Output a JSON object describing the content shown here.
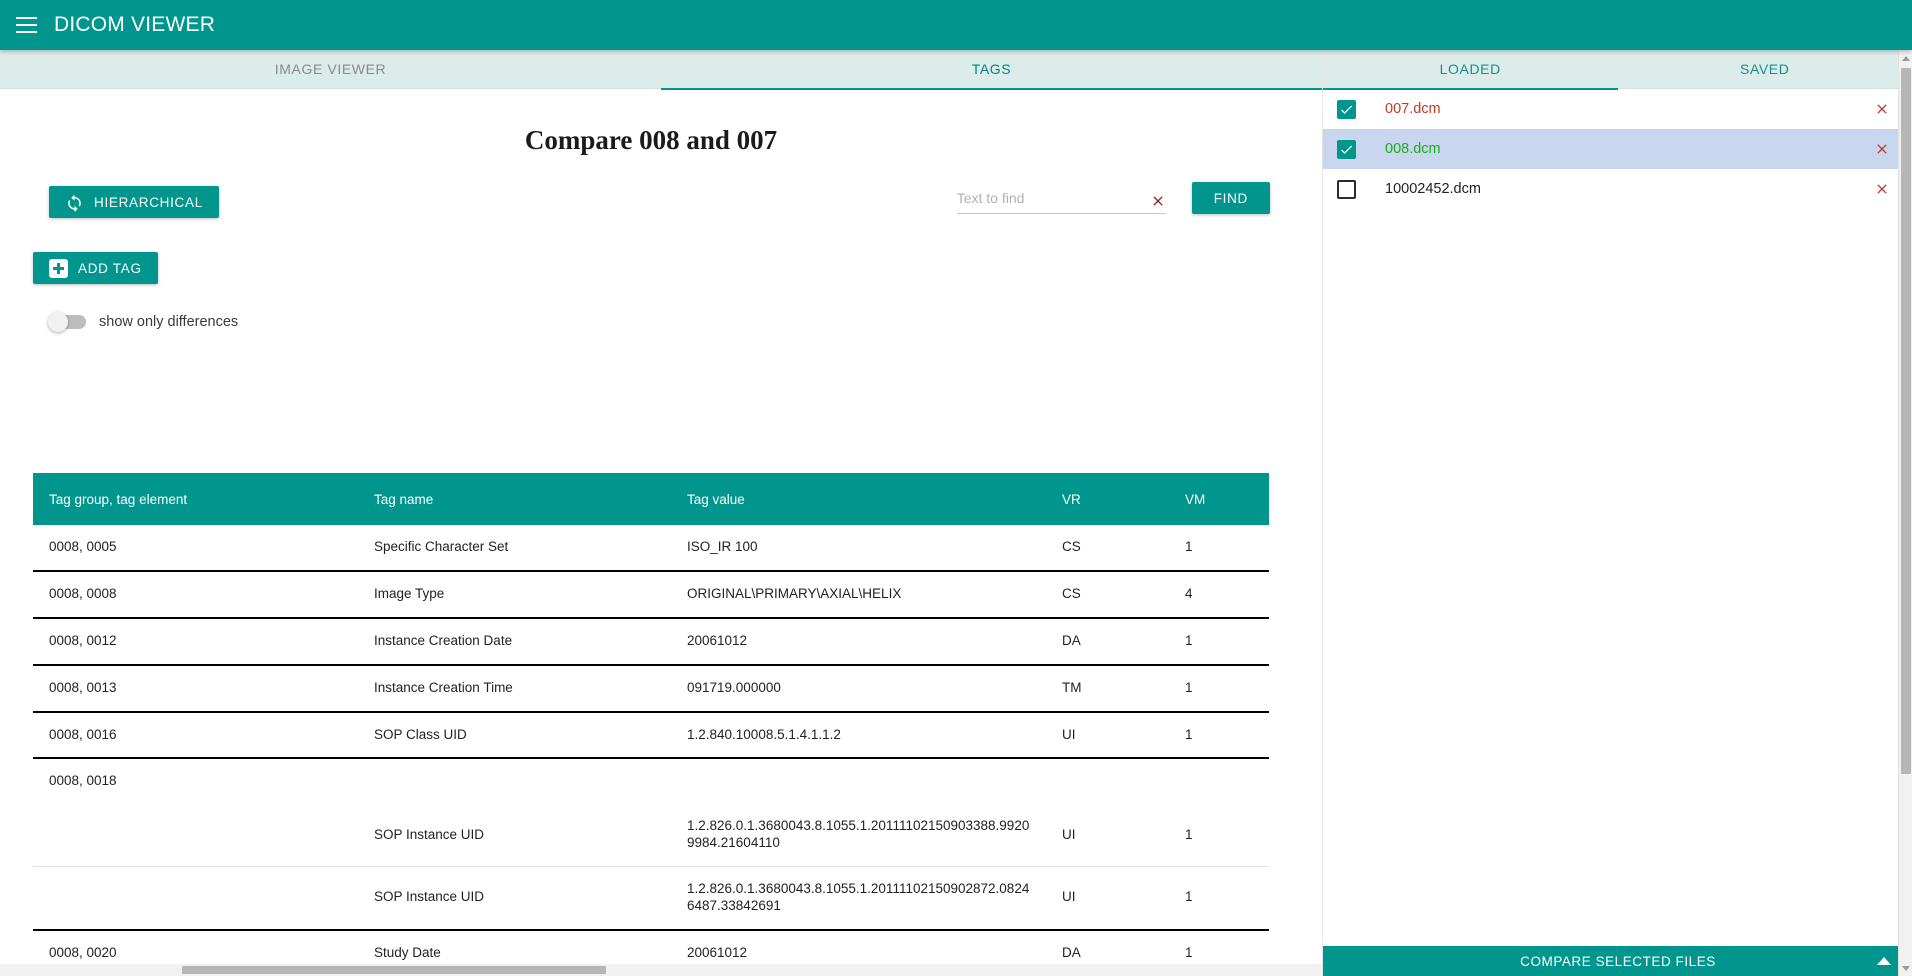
{
  "appbar": {
    "menu_icon": "hamburger-menu-icon",
    "title": "DICOM VIEWER"
  },
  "tabs": {
    "image_viewer": "IMAGE VIEWER",
    "tags": "TAGS",
    "active": "TAGS"
  },
  "main": {
    "page_title": "Compare 008 and 007",
    "hierarchical_button": "HIERARCHICAL",
    "hierarchical_icon": "sync-icon",
    "add_tag_button": "ADD TAG",
    "add_tag_icon": "plus-box-icon",
    "show_only_differences_label": "show only differences",
    "show_only_differences_state": "off"
  },
  "find": {
    "placeholder": "Text to find",
    "value": "",
    "clear_icon": "close-x-icon",
    "button_label": "FIND"
  },
  "table": {
    "columns": [
      "Tag group, tag element",
      "Tag name",
      "Tag value",
      "VR",
      "VM"
    ],
    "rows": [
      {
        "group": "0008, 0005",
        "name": "Specific Character Set",
        "value": "ISO_IR 100",
        "vr": "CS",
        "vm": "1",
        "color": "default",
        "kind": "main"
      },
      {
        "group": "0008, 0008",
        "name": "Image Type",
        "value": "ORIGINAL\\PRIMARY\\AXIAL\\HELIX",
        "vr": "CS",
        "vm": "4",
        "color": "default",
        "kind": "main"
      },
      {
        "group": "0008, 0012",
        "name": "Instance Creation Date",
        "value": "20061012",
        "vr": "DA",
        "vm": "1",
        "color": "default",
        "kind": "main"
      },
      {
        "group": "0008, 0013",
        "name": "Instance Creation Time",
        "value": "091719.000000",
        "vr": "TM",
        "vm": "1",
        "color": "default",
        "kind": "main"
      },
      {
        "group": "0008, 0016",
        "name": "SOP Class UID",
        "value": "1.2.840.10008.5.1.4.1.1.2",
        "vr": "UI",
        "vm": "1",
        "color": "default",
        "kind": "main"
      },
      {
        "group": "0008, 0018",
        "name": "",
        "value": "",
        "vr": "",
        "vm": "",
        "color": "default",
        "kind": "group-head"
      },
      {
        "group": "",
        "name": "SOP Instance UID",
        "value": "1.2.826.0.1.3680043.8.1055.1.20111102150903388.99209984.21604110",
        "vr": "UI",
        "vm": "1",
        "color": "green",
        "kind": "sub"
      },
      {
        "group": "",
        "name": "SOP Instance UID",
        "value": "1.2.826.0.1.3680043.8.1055.1.20111102150902872.08246487.33842691",
        "vr": "UI",
        "vm": "1",
        "color": "red",
        "kind": "sub-last"
      },
      {
        "group": "0008, 0020",
        "name": "Study Date",
        "value": "20061012",
        "vr": "DA",
        "vm": "1",
        "color": "default",
        "kind": "main"
      }
    ]
  },
  "sidebar": {
    "tabs": {
      "loaded": "LOADED",
      "saved": "SAVED",
      "active": "LOADED"
    },
    "files": [
      {
        "name": "007.dcm",
        "checked": true,
        "selected": false,
        "color": "red",
        "delete_icon": "close-x-icon"
      },
      {
        "name": "008.dcm",
        "checked": true,
        "selected": true,
        "color": "green",
        "delete_icon": "close-x-icon"
      },
      {
        "name": "10002452.dcm",
        "checked": false,
        "selected": false,
        "color": "dark",
        "delete_icon": "close-x-icon"
      }
    ],
    "footer_label": "COMPARE SELECTED FILES",
    "footer_icon": "chevron-up-icon"
  },
  "colors": {
    "brand_teal": "#00968d",
    "tabbar_bg": "#dceceb",
    "selected_row": "#c9d6ef",
    "diff_green": "#18b018",
    "diff_red": "#c0392b"
  }
}
